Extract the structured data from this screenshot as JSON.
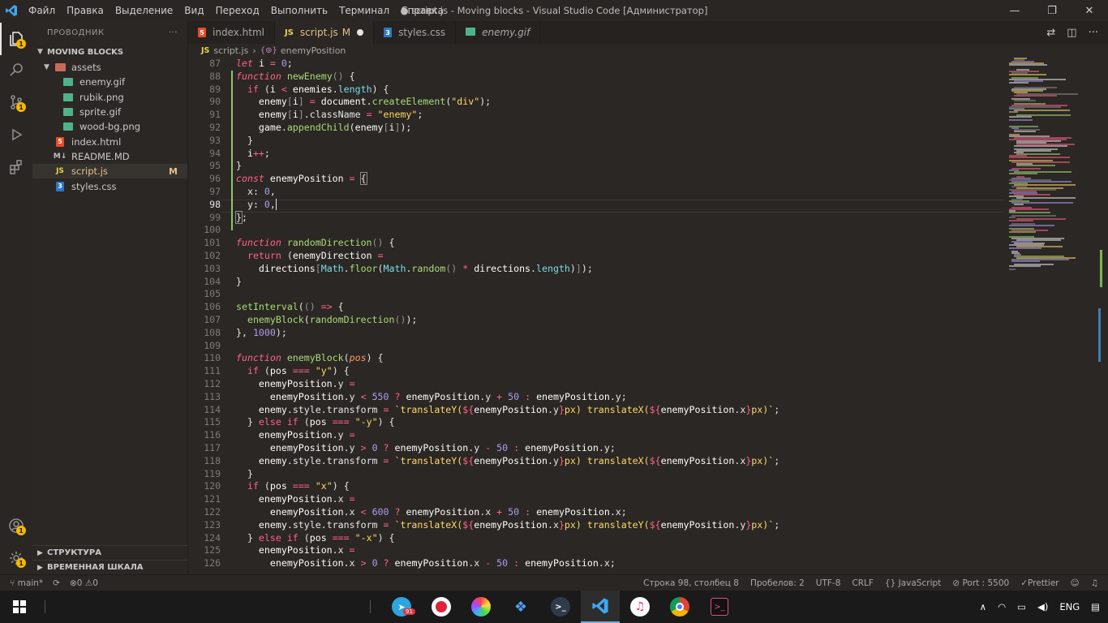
{
  "window": {
    "title": "● script.js - Moving blocks - Visual Studio Code [Администратор]",
    "menu": [
      "Файл",
      "Правка",
      "Выделение",
      "Вид",
      "Переход",
      "Выполнить",
      "Терминал",
      "Справка"
    ]
  },
  "sidebar": {
    "header": "ПРОВОДНИК",
    "more": "···",
    "project": "MOVING BLOCKS",
    "folder": "assets",
    "asset_files": [
      "enemy.gif",
      "rubik.png",
      "sprite.gif",
      "wood-bg.png"
    ],
    "files": [
      {
        "name": "index.html",
        "type": "html"
      },
      {
        "name": "README.MD",
        "type": "md"
      },
      {
        "name": "script.js",
        "type": "js",
        "modified": "M"
      },
      {
        "name": "styles.css",
        "type": "css"
      }
    ],
    "outline": "СТРУКТУРА",
    "timeline": "ВРЕМЕННАЯ ШКАЛА",
    "badge": "1"
  },
  "tabs": [
    {
      "label": "index.html",
      "icon": "5",
      "modified": ""
    },
    {
      "label": "script.js",
      "icon": "JS",
      "modified": "M"
    },
    {
      "label": "styles.css",
      "icon": "3",
      "modified": ""
    },
    {
      "label": "enemy.gif",
      "icon": "img",
      "modified": ""
    }
  ],
  "breadcrumb": {
    "icon": "JS",
    "file": "script.js",
    "symbol": "enemyPosition"
  },
  "editor": {
    "current_line": 98,
    "line_numbers": [
      87,
      88,
      89,
      90,
      91,
      92,
      93,
      94,
      95,
      96,
      97,
      98,
      99,
      100,
      101,
      102,
      103,
      104,
      105,
      106,
      107,
      108,
      109,
      110,
      111,
      112,
      113,
      114,
      115,
      116,
      117,
      118,
      119,
      120,
      121,
      122,
      123,
      124,
      125,
      126
    ]
  },
  "status": {
    "branch": "main*",
    "problems": "0",
    "warnings": "0",
    "position": "Строка 98, столбец 8",
    "spaces": "Пробелов: 2",
    "encoding": "UTF-8",
    "eol": "CRLF",
    "language": "JavaScript",
    "port": "Port : 5500",
    "prettier": "Prettier"
  },
  "taskbar": {
    "telegram_badge": "91",
    "lang": "ENG"
  }
}
